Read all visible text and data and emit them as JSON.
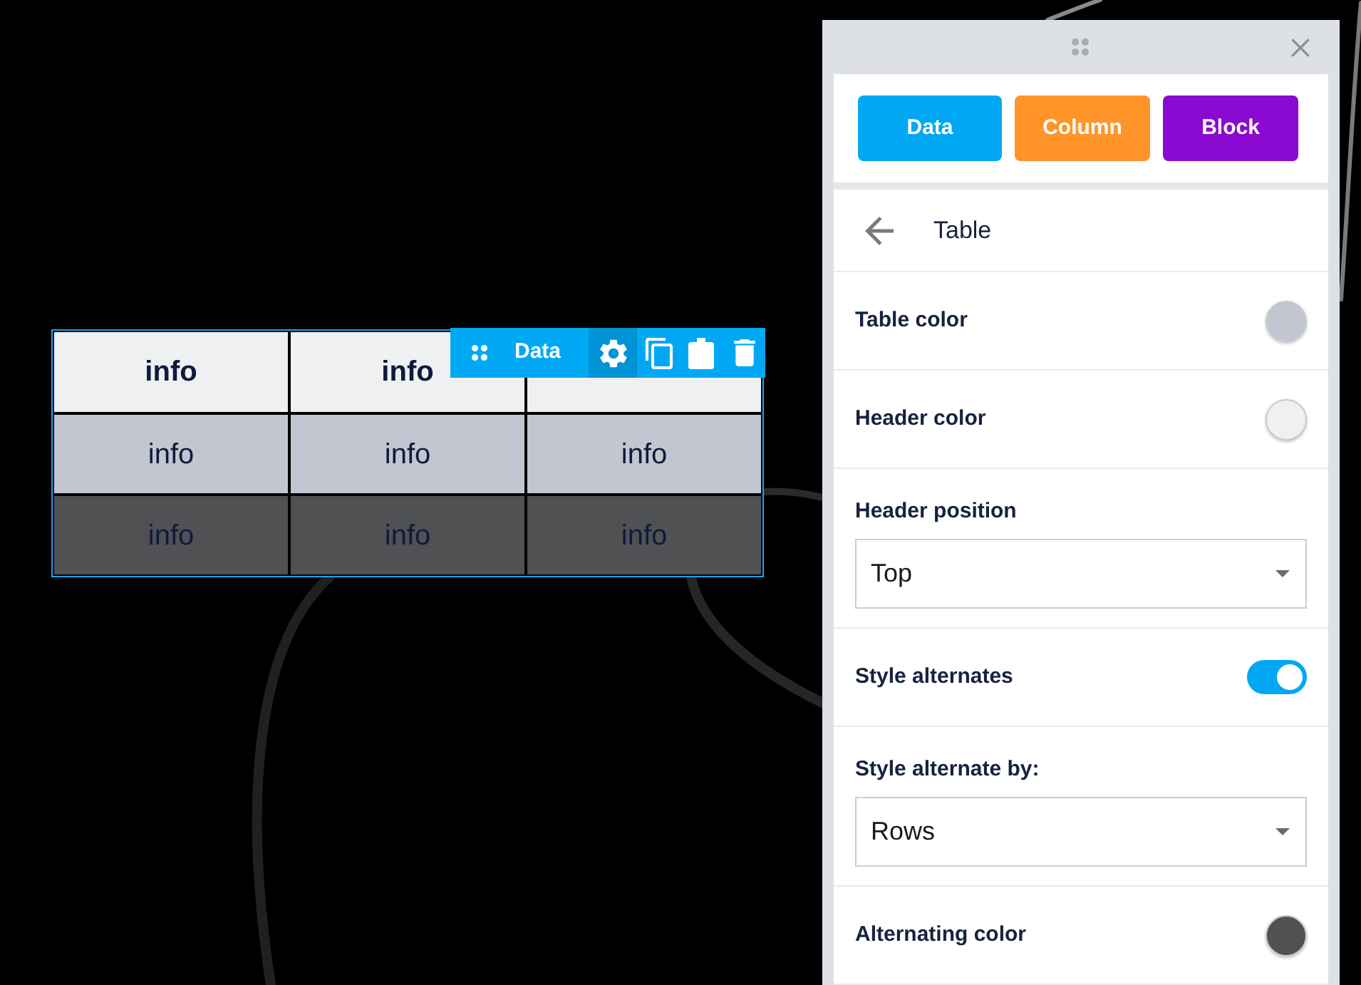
{
  "canvas": {
    "table": {
      "header": [
        "info",
        "info"
      ],
      "rows": [
        [
          "info",
          "info",
          "info"
        ],
        [
          "info",
          "info",
          "info"
        ]
      ]
    },
    "toolbar": {
      "label": "Data",
      "tools": [
        {
          "kind": "settings",
          "selected": true
        },
        {
          "kind": "copy",
          "selected": false
        },
        {
          "kind": "paste",
          "selected": false
        },
        {
          "kind": "delete",
          "selected": false
        }
      ]
    }
  },
  "panel": {
    "buttons": [
      {
        "label": "Data",
        "color": "#00a8f3"
      },
      {
        "label": "Column",
        "color": "#ff9429"
      },
      {
        "label": "Block",
        "color": "#8a0ad1"
      }
    ],
    "title": "Table",
    "settings": [
      {
        "kind": "color",
        "label": "Table color",
        "color": "#c2c6d0"
      },
      {
        "kind": "color",
        "label": "Header color",
        "color": "#eff0f2"
      },
      {
        "kind": "select",
        "label": "Header position",
        "value": "Top"
      },
      {
        "kind": "toggle",
        "label": "Style alternates",
        "on": true
      },
      {
        "kind": "select",
        "label": "Style alternate by:",
        "value": "Rows"
      },
      {
        "kind": "color",
        "label": "Alternating color",
        "color": "#505153"
      }
    ]
  }
}
